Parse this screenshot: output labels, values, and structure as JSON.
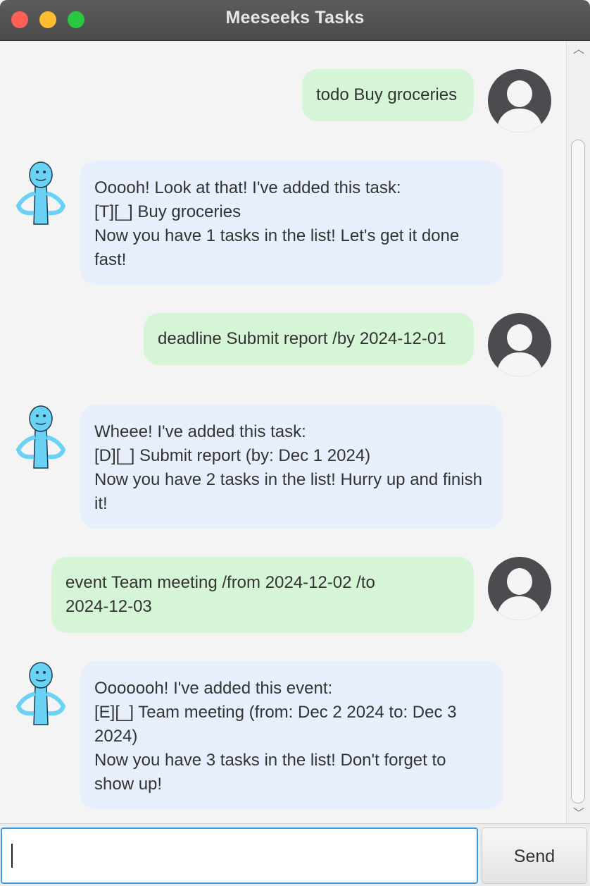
{
  "window": {
    "title": "Meeseeks Tasks"
  },
  "messages": [
    {
      "sender": "user",
      "text": "todo Buy groceries"
    },
    {
      "sender": "bot",
      "text": "Ooooh! Look at that! I've added this task:\n[T][_] Buy groceries\nNow you have 1 tasks in the list! Let's get it done\nfast!"
    },
    {
      "sender": "user",
      "text": "deadline Submit report /by 2024-12-01"
    },
    {
      "sender": "bot",
      "text": "Wheee! I've added this task:\n[D][_] Submit report (by: Dec 1 2024)\nNow you have 2 tasks in the list! Hurry up and finish\nit!"
    },
    {
      "sender": "user",
      "text": "event Team meeting /from 2024-12-02 /to\n2024-12-03"
    },
    {
      "sender": "bot",
      "text": "Ooooooh! I've added this event:\n[E][_] Team meeting (from: Dec 2 2024 to: Dec 3\n2024)\nNow you have 3 tasks in the list! Don't forget to\nshow up!"
    }
  ],
  "input": {
    "value": "",
    "placeholder": ""
  },
  "send_button": {
    "label": "Send"
  },
  "icons": {
    "user_avatar": "user-silhouette-icon",
    "bot_avatar": "meeseeks-icon",
    "scroll_up": "chevron-up-icon",
    "scroll_down": "chevron-down-icon"
  },
  "colors": {
    "user_bubble": "#d6f5d6",
    "bot_bubble": "#e8effc",
    "input_focus": "#3d9ce8"
  }
}
